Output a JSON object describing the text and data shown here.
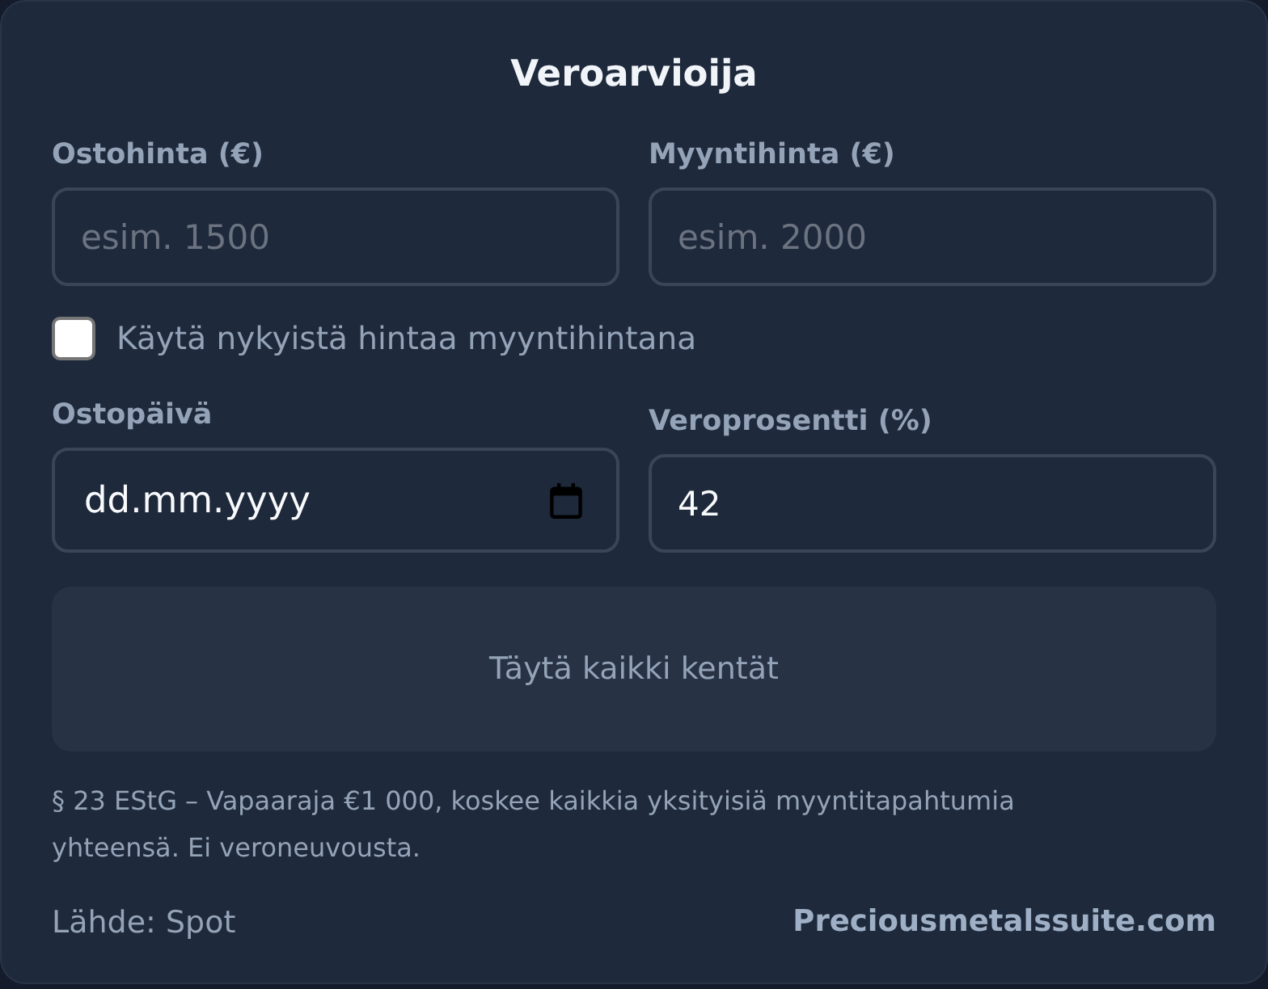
{
  "title": "Veroarvioija",
  "price_fields": [
    {
      "kind": "number",
      "label": "Ostohinta (€)",
      "placeholder": "esim. 1500"
    },
    {
      "kind": "number",
      "label": "Myyntihinta (€)",
      "placeholder": "esim. 2000"
    }
  ],
  "checkbox": {
    "label": "Käytä nykyistä hintaa myyntihintana",
    "checked": false
  },
  "detail_fields": [
    {
      "kind": "date",
      "label": "Ostopäivä",
      "placeholder": "dd.mm.yyyy"
    },
    {
      "kind": "number",
      "label": "Veroprosentti (%)",
      "value": "42"
    }
  ],
  "result": {
    "text": "Täytä kaikki kentät"
  },
  "note": "§ 23 EStG – Vapaaraja €1 000, koskee kaikkia yksityisiä myyntitapahtumia yhteensä. Ei veroneuvousta.",
  "footer": {
    "source": "Lähde: Spot",
    "link": "Preciousmetalssuite.com"
  }
}
